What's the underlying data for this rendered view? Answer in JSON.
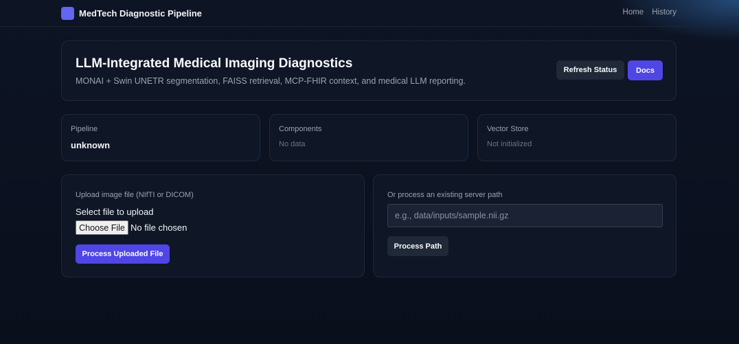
{
  "brand": {
    "name": "MedTech Diagnostic Pipeline",
    "logo_icon": "square-logo-icon",
    "logo_color": "#6366f1"
  },
  "nav": {
    "home": "Home",
    "history": "History"
  },
  "hero": {
    "title": "LLM-Integrated Medical Imaging Diagnostics",
    "subtitle": "MONAI + Swin UNETR segmentation, FAISS retrieval, MCP-FHIR context, and medical LLM reporting.",
    "refresh_label": "Refresh Status",
    "docs_label": "Docs"
  },
  "stats": {
    "pipeline": {
      "label": "Pipeline",
      "value": "unknown"
    },
    "components": {
      "label": "Components",
      "value": "No data"
    },
    "vector_store": {
      "label": "Vector Store",
      "value": "Not initialized"
    }
  },
  "upload": {
    "label": "Upload image file (NIfTI or DICOM)",
    "select_label": "Select file to upload",
    "choose_button": "Choose File",
    "no_file": "No file chosen",
    "process_button": "Process Uploaded File"
  },
  "path": {
    "label": "Or process an existing server path",
    "placeholder": "e.g., data/inputs/sample.nii.gz",
    "value": "",
    "process_button": "Process Path"
  },
  "colors": {
    "accent": "#4f46e5",
    "background": "#0a0f1c",
    "card": "#0f1626"
  }
}
